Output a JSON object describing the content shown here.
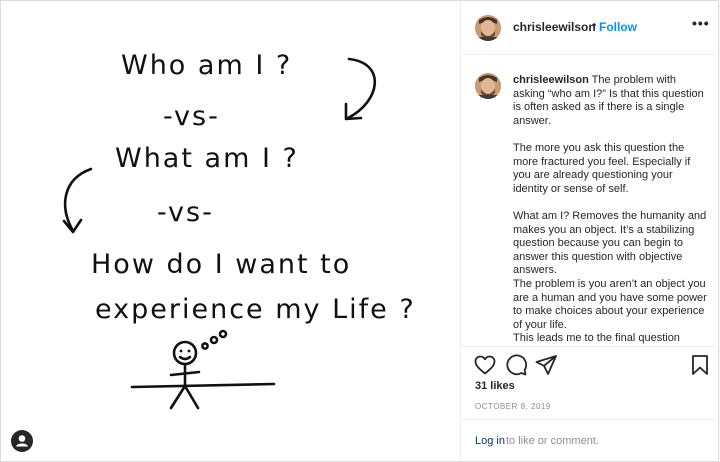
{
  "image": {
    "lines": [
      "Who am I ?",
      "-vs-",
      "What am I ?",
      "-vs-",
      "How do I want to",
      "experience my Life ?"
    ],
    "thought_bubble": "ooo"
  },
  "header": {
    "username": "chrisleewilson",
    "separator": "•",
    "follow_label": "Follow",
    "more_label": "•••"
  },
  "caption": {
    "username": "chrisleewilson",
    "paragraphs": [
      "The problem with asking “who am I?” Is that this question is often asked as if there is a single answer.",
      "The more you ask this question the more fractured you feel. Especially if you are already questioning your identity or sense of self.",
      "What am I? Removes the humanity and makes you an object. It’s a stabilizing question because you can begin to answer this question with objective answers.",
      "The problem is you aren’t an object you are a human and you have some power to make choices about your experience of your life.",
      "This leads me to the final question"
    ]
  },
  "actions": {
    "icons": [
      "heart-icon",
      "comment-icon",
      "share-icon",
      "bookmark-icon"
    ],
    "likes": "31 likes",
    "date": "OCTOBER 8, 2019"
  },
  "login": {
    "link_label": "Log in",
    "rest_label": "to like or comment."
  },
  "colors": {
    "follow_blue": "#0095f6",
    "link_dark_blue": "#00376b",
    "muted_grey": "#8e8e8e",
    "border": "#dbdbdb"
  }
}
